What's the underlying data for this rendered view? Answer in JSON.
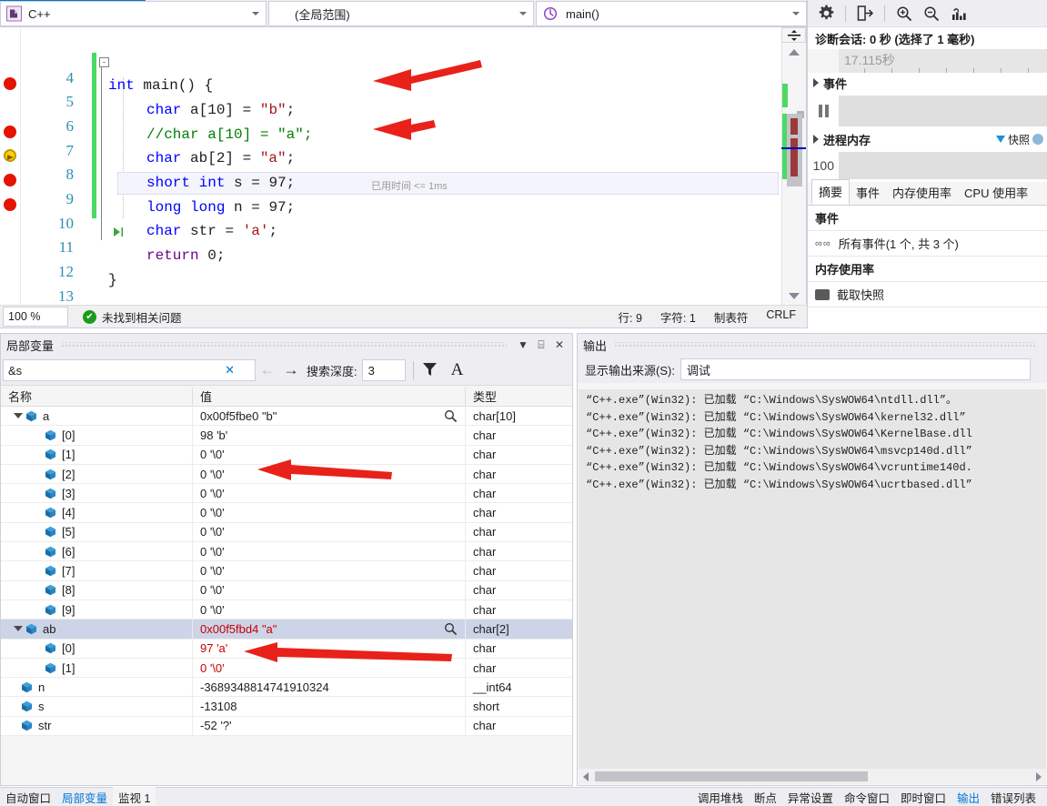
{
  "navbar": {
    "language_combo": "C++",
    "scope_combo": "(全局范围)",
    "function_combo": "main()",
    "icons": [
      "cpp-file-icon",
      "method-icon"
    ]
  },
  "editor": {
    "lines": [
      {
        "num": "4",
        "code": "",
        "breakpoint": "none"
      },
      {
        "num": "5",
        "code": "int main() {",
        "breakpoint": "none"
      },
      {
        "num": "6",
        "code": "char a[10] = \"b\";",
        "breakpoint": "breakpoint"
      },
      {
        "num": "7",
        "code": "//char a[10] = \"a\";",
        "breakpoint": "none"
      },
      {
        "num": "8",
        "code": "char ab[2] = \"a\";",
        "breakpoint": "breakpoint"
      },
      {
        "num": "9",
        "code": "short int s = 97;",
        "breakpoint": "current"
      },
      {
        "num": "10",
        "code": "long long n = 97;",
        "breakpoint": "breakpoint"
      },
      {
        "num": "11",
        "code": "char str = 'a';",
        "breakpoint": "breakpoint"
      },
      {
        "num": "12",
        "code": "return 0;",
        "breakpoint": "none"
      },
      {
        "num": "13",
        "code": "}",
        "breakpoint": "none"
      }
    ],
    "elapsed_time": "已用时间 <= 1ms",
    "fold_glyph": "-"
  },
  "statusbar": {
    "zoom": "100 %",
    "problems": "未找到相关问题",
    "line": "行: 9",
    "char": "字符: 1",
    "tabs": "制表符",
    "eol": "CRLF"
  },
  "diagnostics": {
    "toolbar_icons": [
      "gear-icon",
      "export-icon",
      "zoom-in-icon",
      "zoom-out-icon",
      "chart-icon"
    ],
    "session_title": "诊断会话: 0 秒 (选择了 1 毫秒)",
    "ruler_label": "17.115秒",
    "events_section": "事件",
    "process_memory_section": "进程内存",
    "memory_axis_max": "100",
    "snapshot_legend": "快照",
    "tabs": [
      {
        "label": "摘要",
        "active": true
      },
      {
        "label": "事件",
        "active": false
      },
      {
        "label": "内存使用率",
        "active": false
      },
      {
        "label": "CPU 使用率",
        "active": false
      }
    ],
    "summary_groups": [
      {
        "header": "事件",
        "row": "所有事件(1 个, 共 3 个)",
        "icon": "events-icon"
      },
      {
        "header": "内存使用率",
        "row": "截取快照",
        "icon": "camera-icon"
      }
    ]
  },
  "locals": {
    "title": "局部变量",
    "header_buttons": [
      "chevron-down-icon",
      "pin-icon",
      "close-icon"
    ],
    "search_value": "&s",
    "search_clear": "✕",
    "nav_back": "←",
    "nav_forward": "→",
    "depth_label": "搜索深度:",
    "depth_value": "3",
    "filter_icon": "funnel-icon",
    "match_case_icon": "match-case-icon",
    "columns": [
      "名称",
      "值",
      "类型"
    ],
    "rows": [
      {
        "name": "a",
        "value": "0x00f5fbe0 \"b\"",
        "type": "char[10]",
        "indent": 0,
        "expander": "expanded",
        "changed": false,
        "selected": false,
        "magnifier": true
      },
      {
        "name": "[0]",
        "value": "98 'b'",
        "type": "char",
        "indent": 1,
        "expander": "none",
        "changed": false,
        "selected": false,
        "magnifier": false
      },
      {
        "name": "[1]",
        "value": "0 '\\0'",
        "type": "char",
        "indent": 1,
        "expander": "none",
        "changed": false,
        "selected": false,
        "magnifier": false
      },
      {
        "name": "[2]",
        "value": "0 '\\0'",
        "type": "char",
        "indent": 1,
        "expander": "none",
        "changed": false,
        "selected": false,
        "magnifier": false
      },
      {
        "name": "[3]",
        "value": "0 '\\0'",
        "type": "char",
        "indent": 1,
        "expander": "none",
        "changed": false,
        "selected": false,
        "magnifier": false
      },
      {
        "name": "[4]",
        "value": "0 '\\0'",
        "type": "char",
        "indent": 1,
        "expander": "none",
        "changed": false,
        "selected": false,
        "magnifier": false
      },
      {
        "name": "[5]",
        "value": "0 '\\0'",
        "type": "char",
        "indent": 1,
        "expander": "none",
        "changed": false,
        "selected": false,
        "magnifier": false
      },
      {
        "name": "[6]",
        "value": "0 '\\0'",
        "type": "char",
        "indent": 1,
        "expander": "none",
        "changed": false,
        "selected": false,
        "magnifier": false
      },
      {
        "name": "[7]",
        "value": "0 '\\0'",
        "type": "char",
        "indent": 1,
        "expander": "none",
        "changed": false,
        "selected": false,
        "magnifier": false
      },
      {
        "name": "[8]",
        "value": "0 '\\0'",
        "type": "char",
        "indent": 1,
        "expander": "none",
        "changed": false,
        "selected": false,
        "magnifier": false
      },
      {
        "name": "[9]",
        "value": "0 '\\0'",
        "type": "char",
        "indent": 1,
        "expander": "none",
        "changed": false,
        "selected": false,
        "magnifier": false
      },
      {
        "name": "ab",
        "value": "0x00f5fbd4 \"a\"",
        "type": "char[2]",
        "indent": 0,
        "expander": "expanded",
        "changed": true,
        "selected": true,
        "magnifier": true
      },
      {
        "name": "[0]",
        "value": "97 'a'",
        "type": "char",
        "indent": 1,
        "expander": "none",
        "changed": true,
        "selected": false,
        "magnifier": false
      },
      {
        "name": "[1]",
        "value": "0 '\\0'",
        "type": "char",
        "indent": 1,
        "expander": "none",
        "changed": true,
        "selected": false,
        "magnifier": false
      },
      {
        "name": "n",
        "value": "-3689348814741910324",
        "type": "__int64",
        "indent": 0,
        "expander": "none",
        "changed": false,
        "selected": false,
        "magnifier": false
      },
      {
        "name": "s",
        "value": "-13108",
        "type": "short",
        "indent": 0,
        "expander": "none",
        "changed": false,
        "selected": false,
        "magnifier": false
      },
      {
        "name": "str",
        "value": "-52 '?'",
        "type": "char",
        "indent": 0,
        "expander": "none",
        "changed": false,
        "selected": false,
        "magnifier": false
      }
    ]
  },
  "output": {
    "title": "输出",
    "source_label": "显示输出来源(S):",
    "source_value": "调试",
    "lines": [
      "“C++.exe”(Win32): 已加载 “C:\\Windows\\SysWOW64\\ntdll.dll”。",
      "“C++.exe”(Win32): 已加载 “C:\\Windows\\SysWOW64\\kernel32.dll”",
      "“C++.exe”(Win32): 已加载 “C:\\Windows\\SysWOW64\\KernelBase.dll",
      "“C++.exe”(Win32): 已加载 “C:\\Windows\\SysWOW64\\msvcp140d.dll”",
      "“C++.exe”(Win32): 已加载 “C:\\Windows\\SysWOW64\\vcruntime140d.",
      "“C++.exe”(Win32): 已加载 “C:\\Windows\\SysWOW64\\ucrtbased.dll”"
    ]
  },
  "bottom_tabs": {
    "left": [
      {
        "label": "自动窗口",
        "active": false,
        "selected": false
      },
      {
        "label": "局部变量",
        "active": true,
        "selected": false
      },
      {
        "label": "监视 1",
        "active": false,
        "selected": true
      }
    ],
    "right": [
      {
        "label": "调用堆栈",
        "active": false
      },
      {
        "label": "断点",
        "active": false
      },
      {
        "label": "异常设置",
        "active": false
      },
      {
        "label": "命令窗口",
        "active": false
      },
      {
        "label": "即时窗口",
        "active": false
      },
      {
        "label": "输出",
        "active": true
      },
      {
        "label": "错误列表",
        "active": false
      }
    ]
  },
  "annotations": {
    "arrow_color": "#e8221a",
    "arrows": [
      "arrow-line6",
      "arrow-line8",
      "arrow-var-a0",
      "arrow-var-ab0"
    ]
  }
}
